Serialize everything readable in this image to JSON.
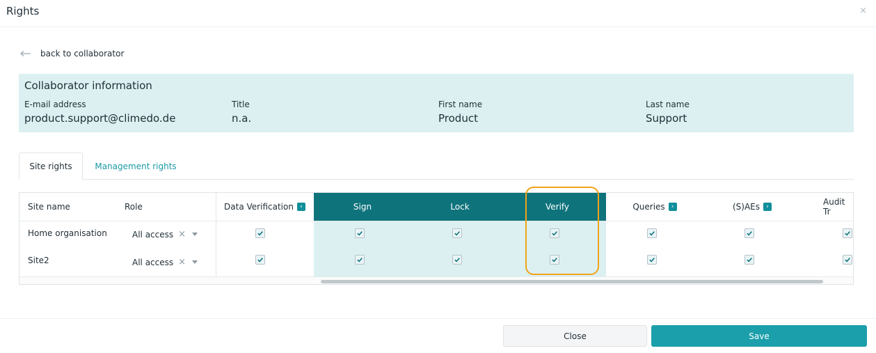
{
  "modal": {
    "title": "Rights",
    "close_glyph": "×"
  },
  "back": {
    "label": "back to collaborator",
    "icon": "arrow-left-icon"
  },
  "collaborator": {
    "heading": "Collaborator information",
    "fields": [
      {
        "label": "E-mail address",
        "value": "product.support@climedo.de"
      },
      {
        "label": "Title",
        "value": "n.a."
      },
      {
        "label": "First name",
        "value": "Product"
      },
      {
        "label": "Last name",
        "value": "Support"
      }
    ]
  },
  "tabs": [
    {
      "label": "Site rights",
      "active": true
    },
    {
      "label": "Management rights",
      "active": false
    }
  ],
  "table": {
    "headers": {
      "site_name": "Site name",
      "role": "Role",
      "data_verification": "Data Verification",
      "sign": "Sign",
      "lock": "Lock",
      "verify": "Verify",
      "queries": "Queries",
      "saes": "(S)AEs",
      "audit_trail": "Audit Tr"
    },
    "badges": {
      "collapse": "‹",
      "expand": "›"
    },
    "rows": [
      {
        "site": "Home organisation",
        "role": "All access",
        "clear": "×",
        "checked": [
          true,
          true,
          true,
          true,
          true,
          true,
          true
        ]
      },
      {
        "site": "Site2",
        "role": "All access",
        "clear": "×",
        "checked": [
          true,
          true,
          true,
          true,
          true,
          true,
          true
        ]
      }
    ]
  },
  "colors": {
    "accent": "#1b9fab",
    "header_dark": "#0f737c",
    "panel_bg": "#dcf0f1",
    "highlight": "#f0a318"
  },
  "footer": {
    "close_label": "Close",
    "save_label": "Save"
  }
}
